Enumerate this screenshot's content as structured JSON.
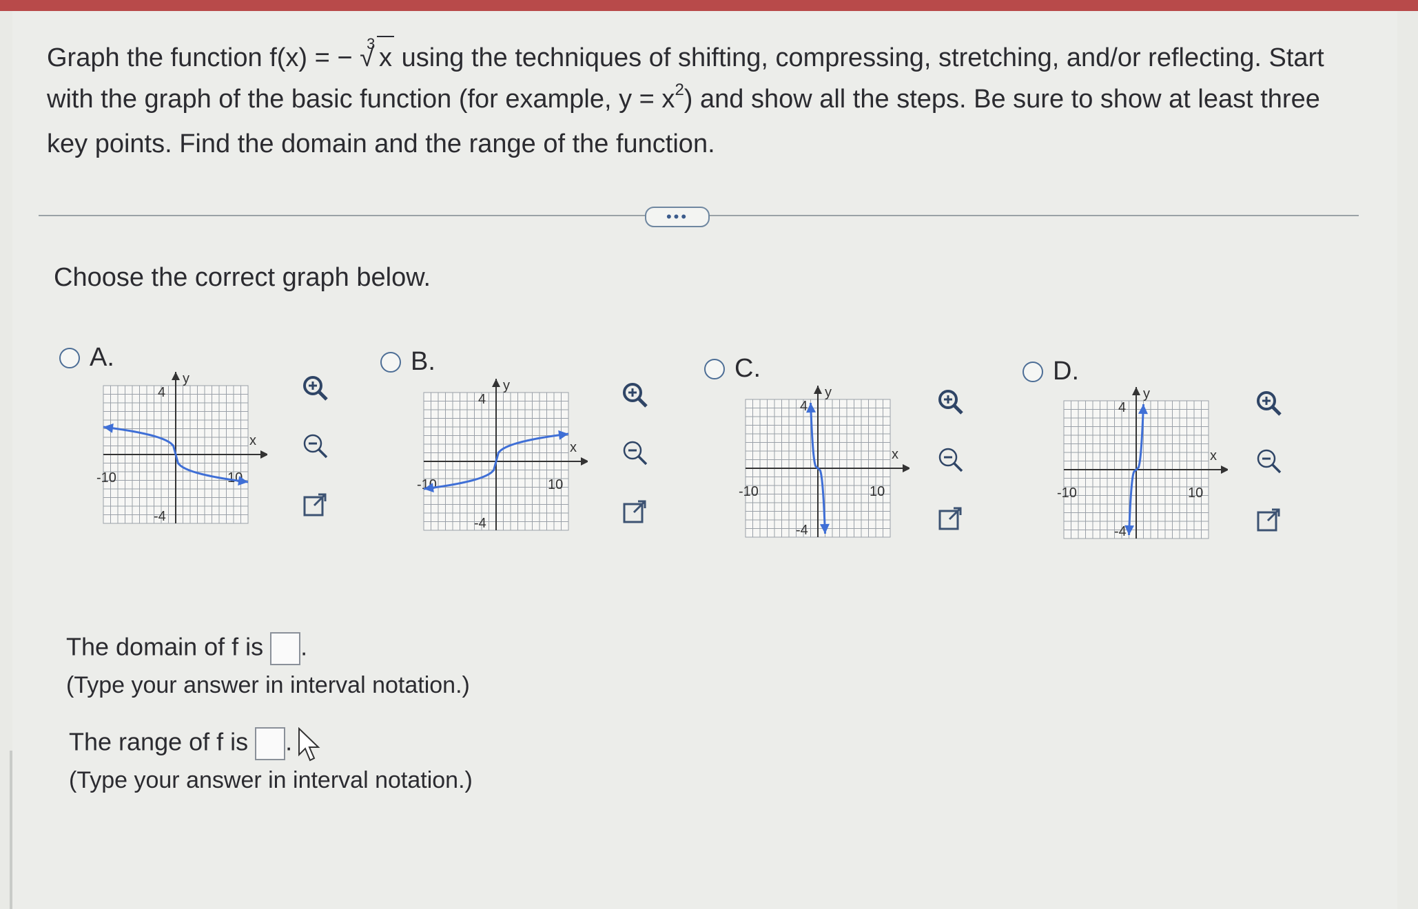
{
  "question": {
    "p1": "Graph the function f(x) = −",
    "rad_index": "3",
    "rad_arg": "x",
    "p2": " using the techniques of shifting, compressing, stretching, and/or reflecting. Start with the graph of the basic function (for example, y = x",
    "sup": "2",
    "p3": ") and show all the steps. Be sure to show at least three key points. Find the domain and the range of the function."
  },
  "more_button": "•••",
  "prompt": "Choose the correct graph below.",
  "options": [
    {
      "letter": "A.",
      "curve": "decreasing-flat"
    },
    {
      "letter": "B.",
      "curve": "increasing-flat"
    },
    {
      "letter": "C.",
      "curve": "decreasing-steep"
    },
    {
      "letter": "D.",
      "curve": "increasing-steep"
    }
  ],
  "graph_labels": {
    "y": "y",
    "x": "x",
    "ytop": "4",
    "ybot": "-4",
    "xleft": "-10",
    "xright": "10"
  },
  "icons": [
    "zoom-in-icon",
    "zoom-out-icon",
    "external-link-icon"
  ],
  "domain": {
    "label": "The domain of f is",
    "hint": "(Type your answer in interval notation.)"
  },
  "range": {
    "label": "The range of f is",
    "hint": "(Type your answer in interval notation.)"
  },
  "colors": {
    "accent": "#4d6e96",
    "curve": "#3f6fd6",
    "grid": "#9aa0a8"
  }
}
